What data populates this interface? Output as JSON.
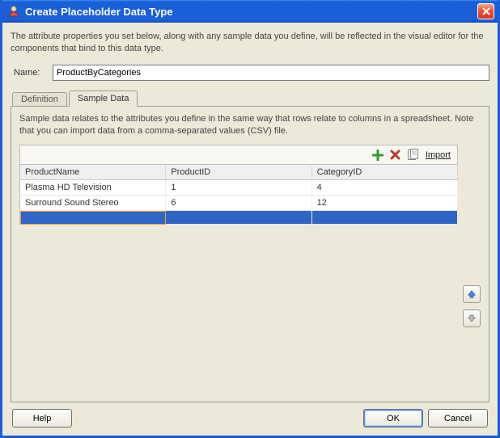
{
  "window": {
    "title": "Create Placeholder Data Type"
  },
  "intro": "The attribute properties you set below, along with any sample data you define, will be reflected in the visual editor for the components that bind to this data type.",
  "name": {
    "label": "Name:",
    "value": "ProductByCategories"
  },
  "tabs": {
    "definition": "Definition",
    "sample_data": "Sample Data",
    "active": "sample_data"
  },
  "tab_desc": "Sample data relates to the attributes you define in the same way that rows relate to columns in a spreadsheet. Note that you can import data from a comma-separated values (CSV) file.",
  "toolbar": {
    "add_icon": "add-icon",
    "delete_icon": "delete-icon",
    "import_icon": "import-file-icon",
    "import_label": "Import"
  },
  "table": {
    "columns": [
      "ProductName",
      "ProductID",
      "CategoryID"
    ],
    "rows": [
      {
        "ProductName": "Plasma HD Television",
        "ProductID": "1",
        "CategoryID": "4"
      },
      {
        "ProductName": "Surround Sound Stereo",
        "ProductID": "6",
        "CategoryID": "12"
      },
      {
        "ProductName": "",
        "ProductID": "",
        "CategoryID": ""
      }
    ],
    "selected_index": 2
  },
  "buttons": {
    "help": "Help",
    "ok": "OK",
    "cancel": "Cancel"
  }
}
